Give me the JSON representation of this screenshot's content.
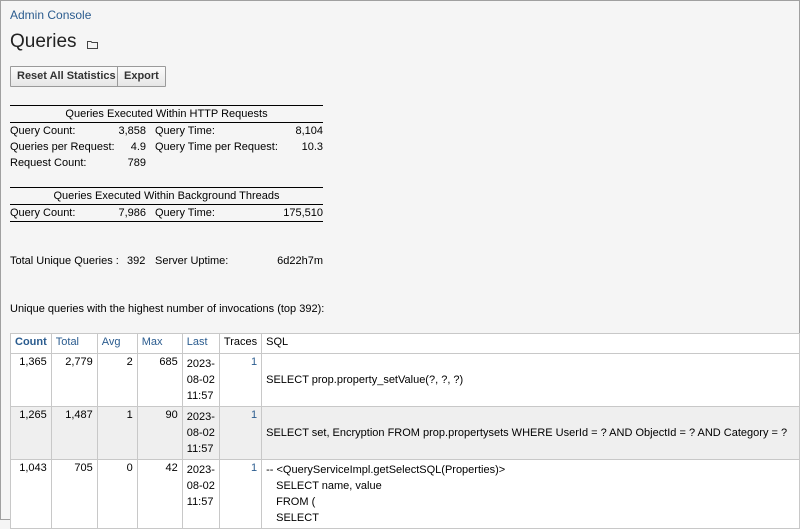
{
  "breadcrumb": "Admin Console",
  "page_title": "Queries",
  "buttons": {
    "reset": "Reset All Statistics",
    "export": "Export"
  },
  "http": {
    "header": "Queries Executed Within HTTP Requests",
    "query_count_label": "Query Count:",
    "query_count": "3,858",
    "query_time_label": "Query Time:",
    "query_time": "8,104",
    "qpr_label": "Queries per Request:",
    "qpr": "4.9",
    "qtpr_label": "Query Time per Request:",
    "qtpr": "10.3",
    "request_count_label": "Request Count:",
    "request_count": "789"
  },
  "bg": {
    "header": "Queries Executed Within Background Threads",
    "query_count_label": "Query Count:",
    "query_count": "7,986",
    "query_time_label": "Query Time:",
    "query_time": "175,510"
  },
  "totals": {
    "unique_label": "Total Unique Queries :",
    "unique": "392",
    "uptime_label": "Server Uptime:",
    "uptime": "6d22h7m"
  },
  "intro": "Unique queries with the highest number of invocations (top 392):",
  "table": {
    "headers": [
      "Count",
      "Total",
      "Avg",
      "Max",
      "Last",
      "Traces",
      "SQL"
    ],
    "rows": [
      {
        "count": "1,365",
        "total": "2,779",
        "avg": "2",
        "max": "685",
        "last": [
          "2023-",
          "08-02",
          "11:57"
        ],
        "traces": "1",
        "sql": [
          "SELECT prop.property_setValue(?, ?, ?)"
        ]
      },
      {
        "count": "1,265",
        "total": "1,487",
        "avg": "1",
        "max": "90",
        "last": [
          "2023-",
          "08-02",
          "11:57"
        ],
        "traces": "1",
        "sql": [
          "SELECT set, Encryption FROM prop.propertysets WHERE UserId = ? AND ObjectId = ? AND Category = ?"
        ]
      },
      {
        "count": "1,043",
        "total": "705",
        "avg": "0",
        "max": "42",
        "last": [
          "2023-",
          "08-02",
          "11:57"
        ],
        "traces": "1",
        "sql": [
          "-- <QueryServiceImpl.getSelectSQL(Properties)>",
          "SELECT name, value",
          "FROM (",
          "SELECT"
        ]
      }
    ]
  }
}
